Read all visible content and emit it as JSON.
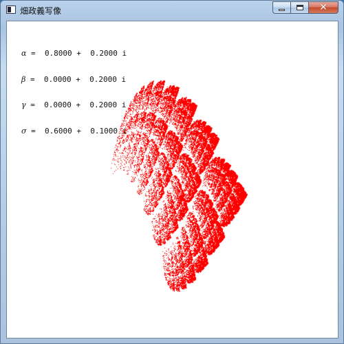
{
  "window": {
    "title": "畑政義写像"
  },
  "parameters": [
    {
      "symbol": "α",
      "re": "0.8000",
      "im": "0.2000"
    },
    {
      "symbol": "β",
      "re": "0.0000",
      "im": "0.2000"
    },
    {
      "symbol": "γ",
      "re": "0.0000",
      "im": "0.2000"
    },
    {
      "symbol": "σ",
      "re": "0.6000",
      "im": "0.1000"
    }
  ],
  "plot": {
    "point_color": "#ff0000",
    "background": "#ffffff"
  }
}
